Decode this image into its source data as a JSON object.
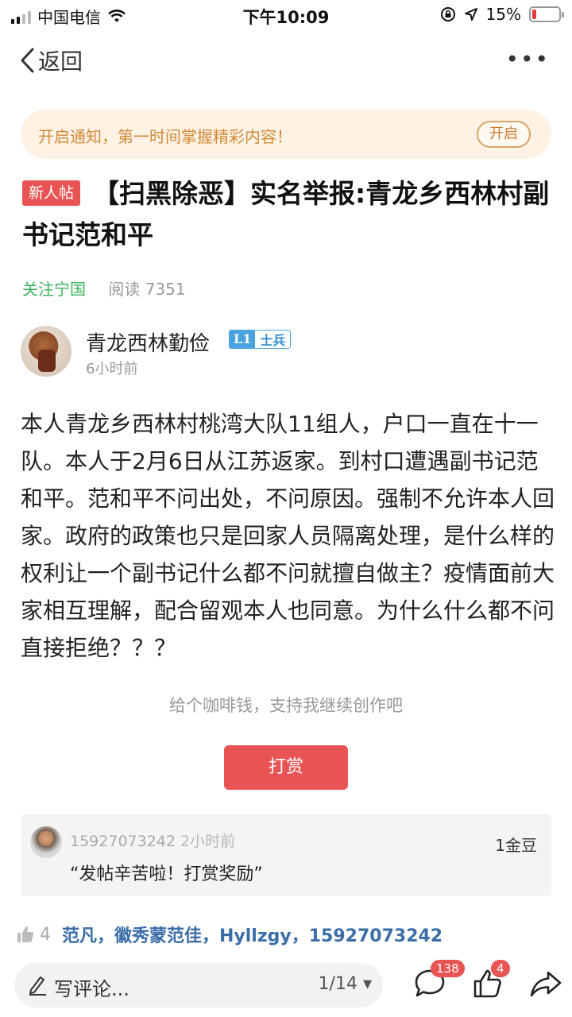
{
  "status_bar": {
    "carrier": "中国电信",
    "time": "下午10:09",
    "battery_percent": "15%",
    "battery_level": 0.15,
    "icons": [
      "signal-icon",
      "wifi-icon",
      "lock-rotation-icon",
      "location-icon",
      "battery-icon"
    ]
  },
  "nav": {
    "back_label": "返回",
    "more_label": "•••"
  },
  "notify": {
    "text": "开启通知，第一时间掌握精彩内容！",
    "button": "开启"
  },
  "post": {
    "tag": "新人帖",
    "title": "【扫黑除恶】实名举报:青龙乡西林村副书记范和平",
    "follow": "关注宁国",
    "reads": "阅读 7351",
    "author": {
      "name": "青龙西林勤俭",
      "level": "L1",
      "rank": "士兵",
      "time": "6小时前"
    },
    "content": "本人青龙乡西林村桃湾大队11组人，户口一直在十一队。本人于2月6日从江苏返家。到村口遭遇副书记范和平。范和平不问出处，不问原因。强制不允许本人回家。政府的政策也只是回家人员隔离处理，是什么样的权利让一个副书记什么都不问就擅自做主？疫情面前大家相互理解，配合留观本人也同意。为什么什么都不问直接拒绝？？？"
  },
  "reward": {
    "tip": "给个咖啡钱，支持我继续创作吧",
    "button": "打赏",
    "record": {
      "user": "15927073242",
      "time": "2小时前",
      "amount": "1金豆",
      "message": "“发帖辛苦啦！打赏奖励”"
    }
  },
  "likes": {
    "count": "4",
    "names": "范凡，徽秀蒙范佳，Hyllzgy，15927073242"
  },
  "bottom_bar": {
    "placeholder": "写评论...",
    "page": "1/14 ▾",
    "comment_count": "138",
    "like_count": "4"
  },
  "colors": {
    "accent_red": "#e85454",
    "follow_green": "#3cb35d",
    "notify_bg": "#fdf2e4",
    "link_blue": "#3b6ea8"
  }
}
